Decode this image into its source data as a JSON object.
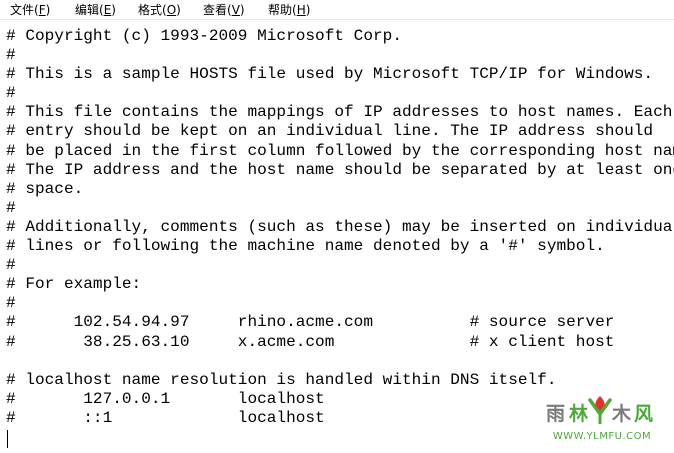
{
  "menu": [
    {
      "label": "文件(",
      "key": "F",
      "tail": ")"
    },
    {
      "label": "编辑(",
      "key": "E",
      "tail": ")"
    },
    {
      "label": "格式(",
      "key": "O",
      "tail": ")"
    },
    {
      "label": "查看(",
      "key": "V",
      "tail": ")"
    },
    {
      "label": "帮助(",
      "key": "H",
      "tail": ")"
    }
  ],
  "editor": {
    "lines": [
      "# Copyright (c) 1993-2009 Microsoft Corp.",
      "#",
      "# This is a sample HOSTS file used by Microsoft TCP/IP for Windows.",
      "#",
      "# This file contains the mappings of IP addresses to host names. Each",
      "# entry should be kept on an individual line. The IP address should",
      "# be placed in the first column followed by the corresponding host name.",
      "# The IP address and the host name should be separated by at least one",
      "# space.",
      "#",
      "# Additionally, comments (such as these) may be inserted on individual",
      "# lines or following the machine name denoted by a '#' symbol.",
      "#",
      "# For example:",
      "#",
      "#      102.54.94.97     rhino.acme.com          # source server",
      "#       38.25.63.10     x.acme.com              # x client host",
      "",
      "# localhost name resolution is handled within DNS itself.",
      "#\t127.0.0.1       localhost",
      "#\t::1             localhost"
    ]
  },
  "watermark": {
    "brand": "雨林木风",
    "url": "WWW.YLMFU.COM",
    "colors": {
      "green": "#4fa83a",
      "red": "#e4322b",
      "gray": "#7a7a7a"
    }
  }
}
